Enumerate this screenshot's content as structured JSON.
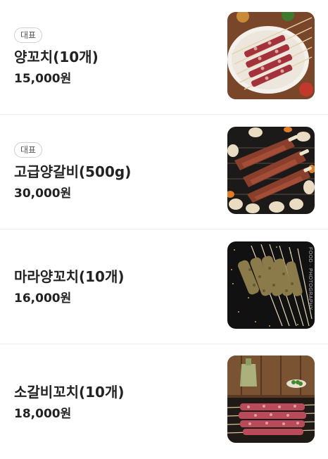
{
  "menu": {
    "items": [
      {
        "badge": "대표",
        "name": "양꼬치(10개)",
        "price": "15,000원",
        "image_icon": "lamb-skewers-photo"
      },
      {
        "badge": "대표",
        "name": "고급양갈비(500g)",
        "price": "30,000원",
        "image_icon": "lamb-ribs-photo"
      },
      {
        "name": "마라양꼬치(10개)",
        "price": "16,000원",
        "image_icon": "mala-lamb-skewers-photo",
        "image_watermark": "FOOD · PHOTOGRAPHY"
      },
      {
        "name": "소갈비꼬치(10개)",
        "price": "18,000원",
        "image_icon": "beef-rib-skewers-photo"
      }
    ]
  }
}
